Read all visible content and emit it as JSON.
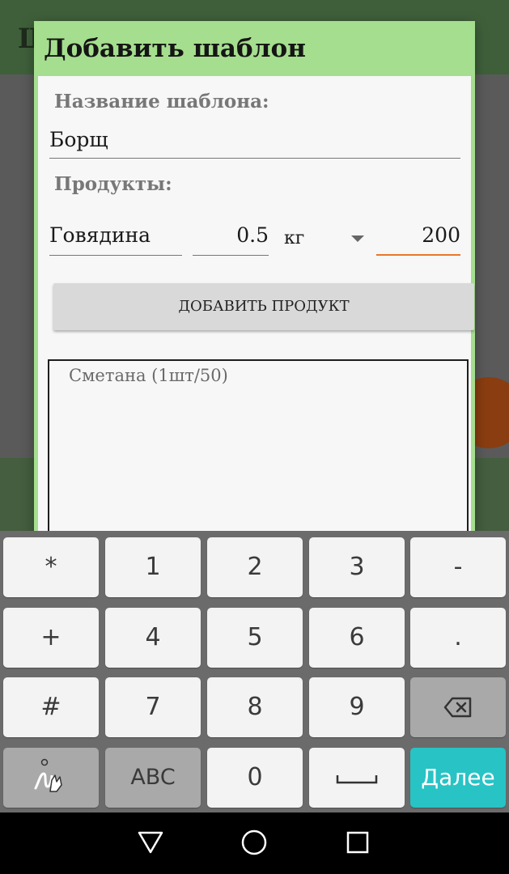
{
  "background_app": {
    "title_partial": "Ш"
  },
  "dialog": {
    "title": "Добавить шаблон",
    "template_name_label": "Название шаблона:",
    "template_name_value": "Борщ",
    "products_label": "Продукты:",
    "product_name": "Говядина",
    "quantity": "0.5",
    "unit": "кг",
    "price": "200",
    "add_product_button": "ДОБАВИТЬ ПРОДУКТ",
    "products_list_text": "Сметана (1шт/50)"
  },
  "keyboard": {
    "rows": [
      [
        "*",
        "1",
        "2",
        "3",
        "-"
      ],
      [
        "+",
        "4",
        "5",
        "6",
        "."
      ],
      [
        "#",
        "7",
        "8",
        "9",
        "backspace"
      ],
      [
        "handwriting",
        "ABC",
        "0",
        "space",
        "Далее"
      ]
    ],
    "abc_label": "ABC",
    "enter_label": "Далее"
  },
  "colors": {
    "dialog_header": "#a5de8e",
    "focused_underline": "#e8772a",
    "enter_key": "#28c3c5"
  },
  "icons": {
    "dropdown": "triangle-down",
    "backspace": "backspace-icon",
    "space": "space-bar-icon",
    "handwriting": "handwriting-icon",
    "nav_back": "triangle-left",
    "nav_home": "circle",
    "nav_recents": "square"
  }
}
